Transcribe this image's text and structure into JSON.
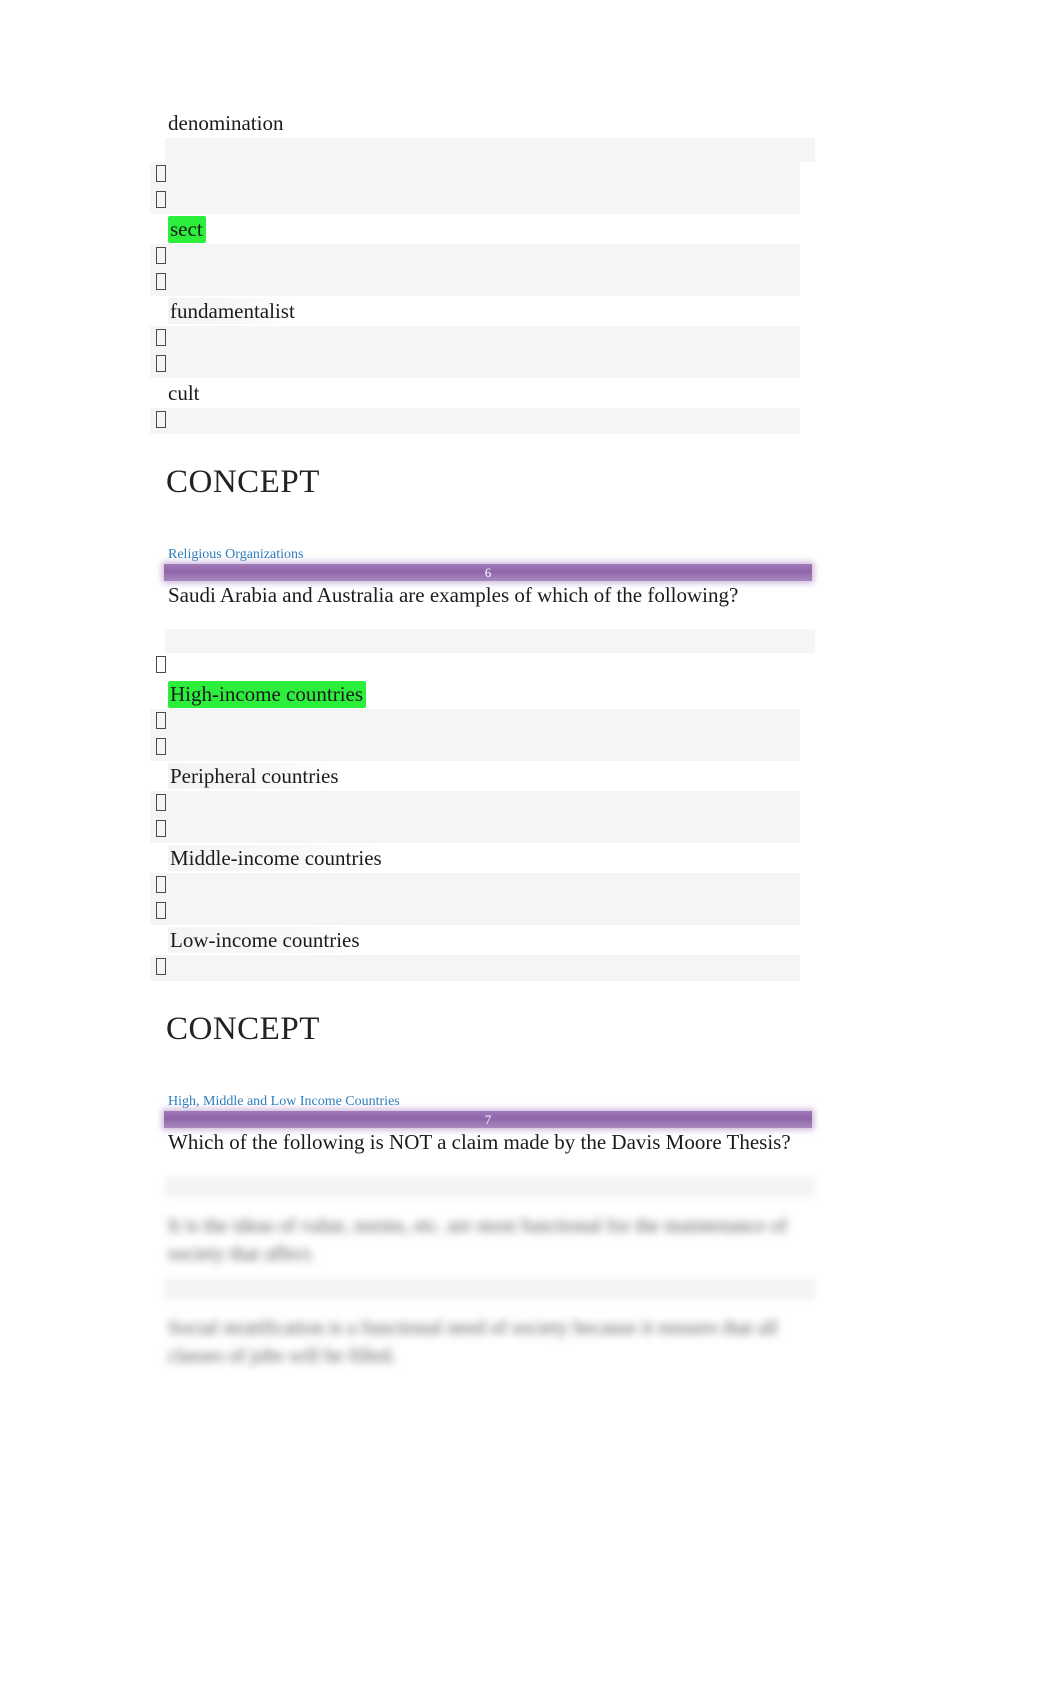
{
  "document": {
    "type": "quiz-review",
    "colors": {
      "highlight_green": "#2bef3a",
      "question_bar_purple": "#9f79b8",
      "concept_link_blue": "#2e7ebd",
      "row_band_gray": "#f5f5f5",
      "text": "#1b1b1b"
    },
    "radio_glyph": "tofu-missing-glyph-box"
  },
  "question_5_tail": {
    "options": [
      {
        "label": "denomination",
        "highlighted": false
      },
      {
        "label": "sect",
        "highlighted": true
      },
      {
        "label": "fundamentalist",
        "highlighted": false
      },
      {
        "label": "cult",
        "highlighted": false
      }
    ]
  },
  "concept_1": {
    "heading": "CONCEPT",
    "link": "Religious Organizations"
  },
  "question_6": {
    "number": "6",
    "text": "Saudi Arabia and Australia are examples of which of the following?",
    "options": [
      {
        "label": "High-income countries",
        "highlighted": true
      },
      {
        "label": "Peripheral countries",
        "highlighted": false
      },
      {
        "label": "Middle-income countries",
        "highlighted": false
      },
      {
        "label": "Low-income countries",
        "highlighted": false
      }
    ]
  },
  "concept_2": {
    "heading": "CONCEPT",
    "link": "High, Middle and Low Income Countries"
  },
  "question_7": {
    "number": "7",
    "text": "Which of the following is NOT a claim made by the Davis Moore Thesis?",
    "options": [
      {
        "label": "It is the ideas of value, norms, etc. are most functional for the maintenance of society that affect.",
        "blurred": true
      },
      {
        "label": "Social stratification is a functional need of society because it ensures that all classes of jobs will be filled.",
        "blurred": true
      }
    ]
  }
}
